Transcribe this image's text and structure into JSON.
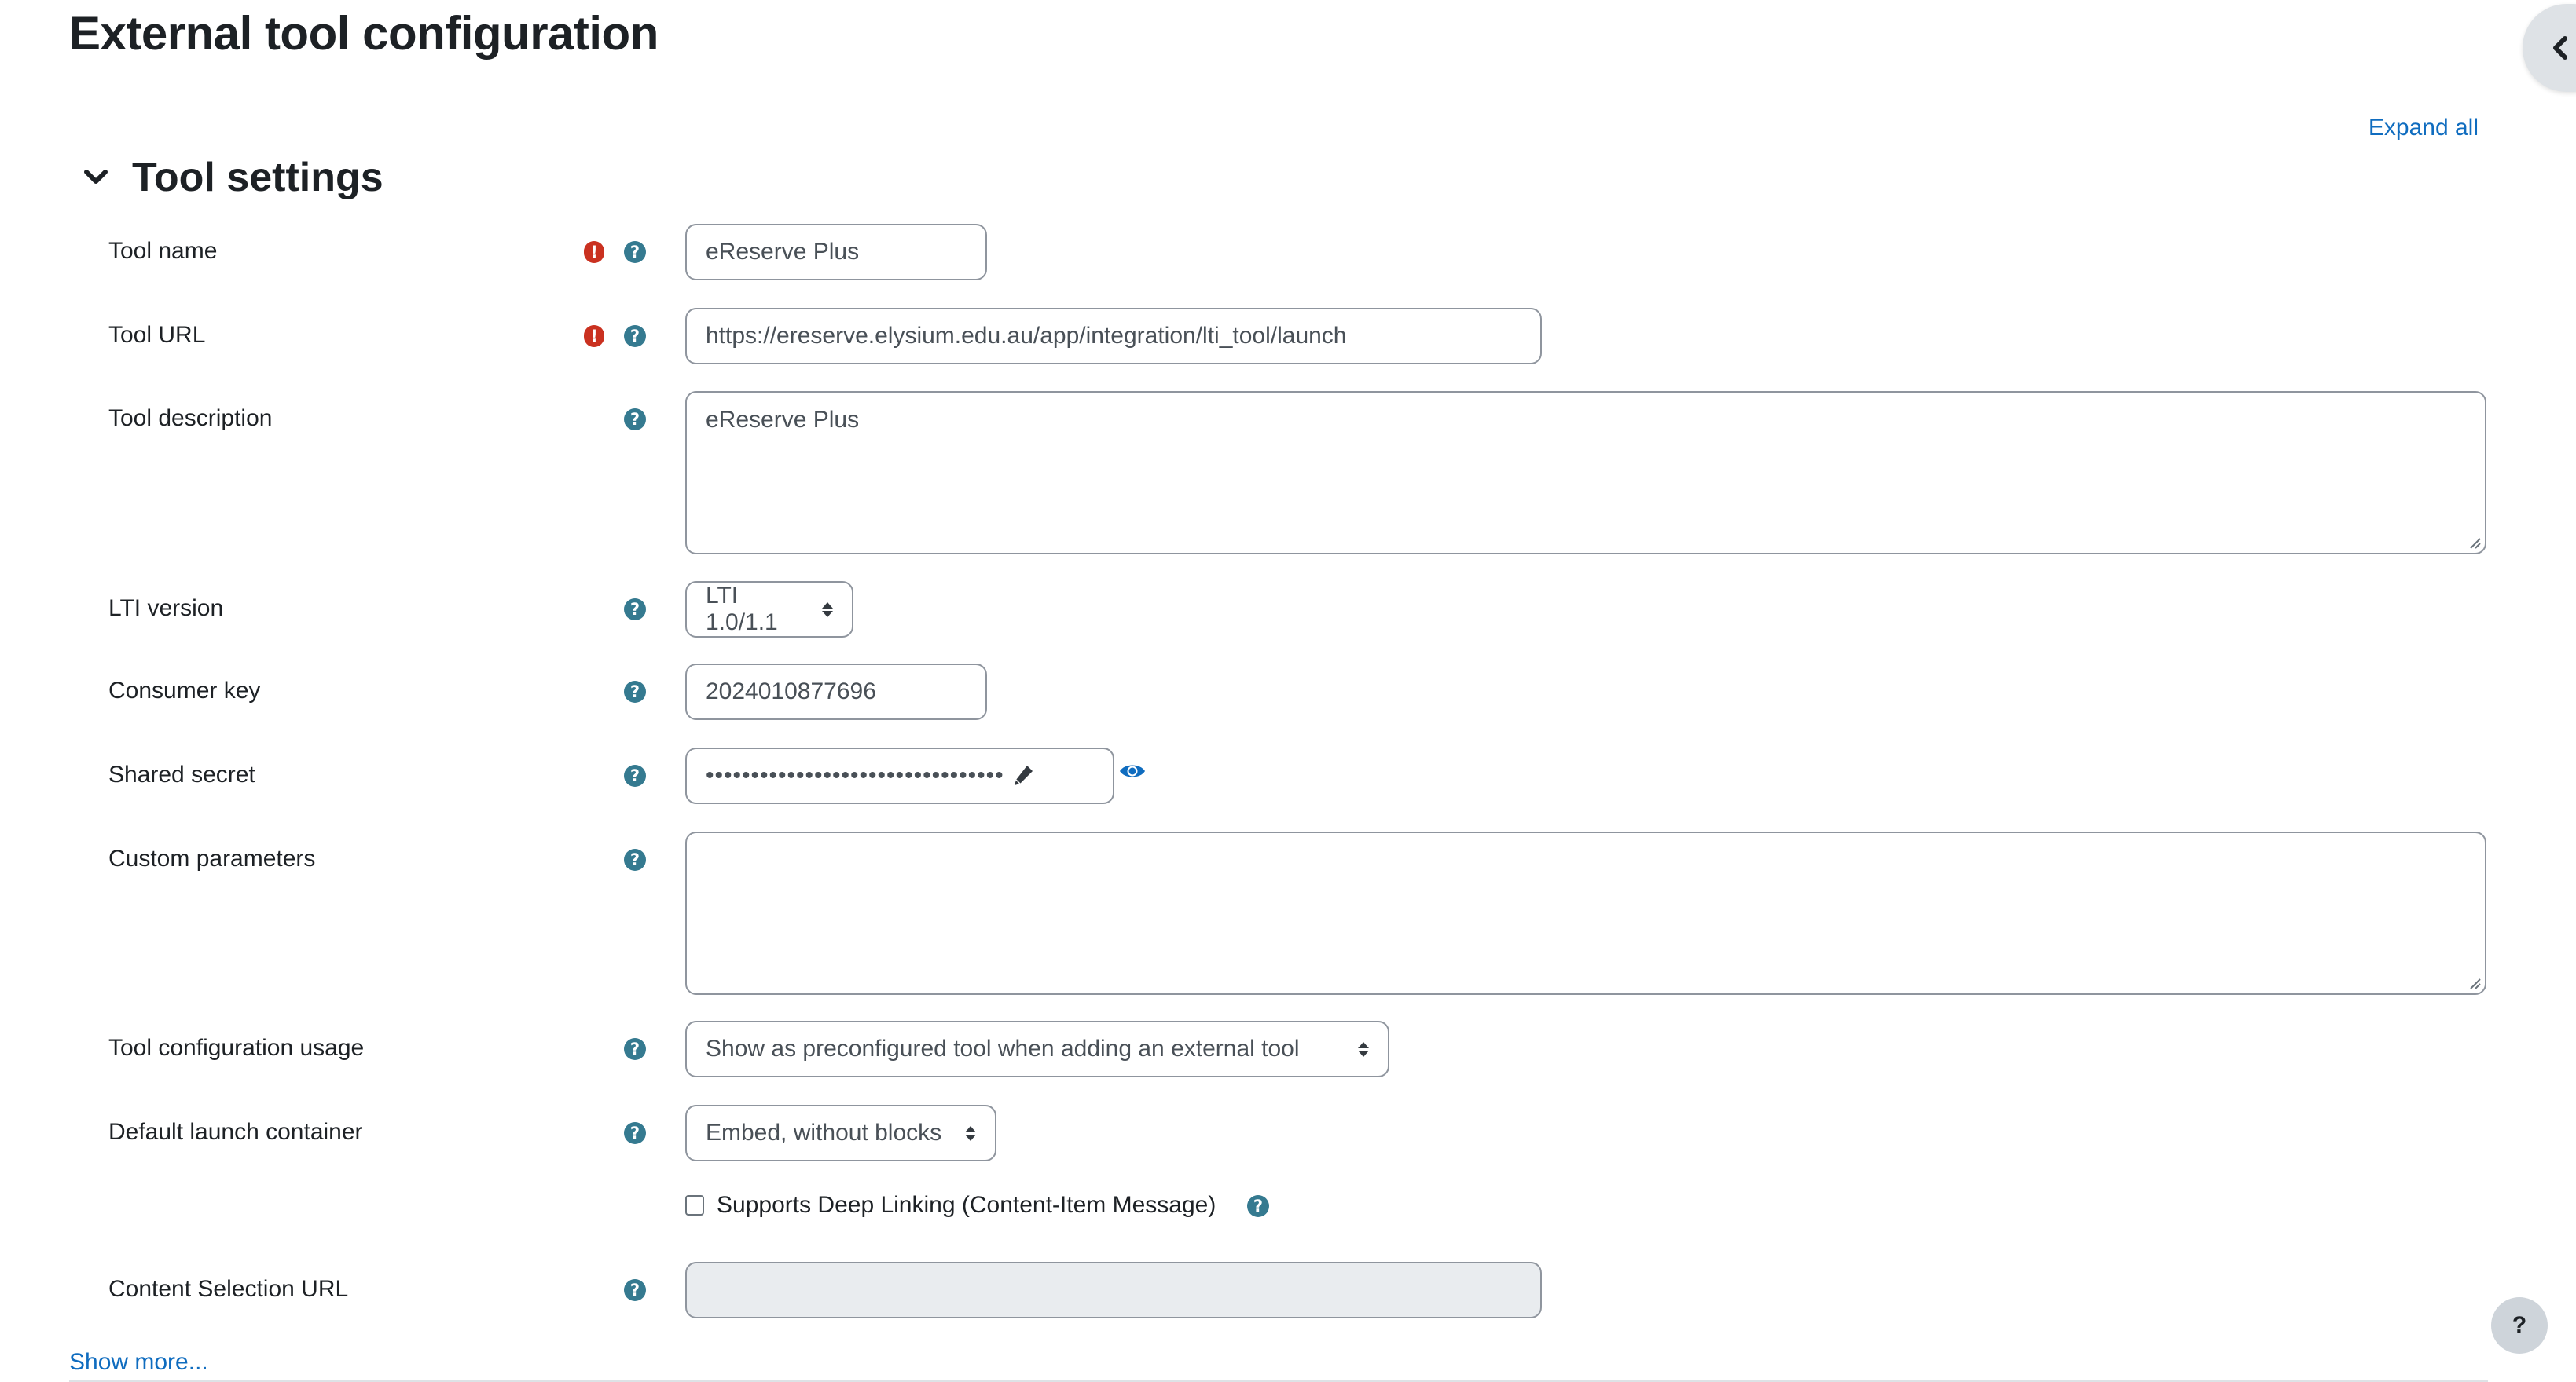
{
  "page": {
    "title": "External tool configuration",
    "expand_all": "Expand all",
    "drawer_toggle_icon": "chevron-left-icon"
  },
  "section": {
    "title": "Tool settings",
    "collapse_icon": "chevron-down-icon"
  },
  "fields": {
    "tool_name": {
      "label": "Tool name",
      "required": true,
      "value": "eReserve Plus"
    },
    "tool_url": {
      "label": "Tool URL",
      "required": true,
      "value": "https://ereserve.elysium.edu.au/app/integration/lti_tool/launch"
    },
    "tool_description": {
      "label": "Tool description",
      "value": "eReserve Plus"
    },
    "lti_version": {
      "label": "LTI version",
      "selected": "LTI 1.0/1.1"
    },
    "consumer_key": {
      "label": "Consumer key",
      "value": "2024010877696"
    },
    "shared_secret": {
      "label": "Shared secret",
      "masked_value": "•••••••••••••••••••••••••••••••••"
    },
    "custom_parameters": {
      "label": "Custom parameters",
      "value": ""
    },
    "tool_config_usage": {
      "label": "Tool configuration usage",
      "selected": "Show as preconfigured tool when adding an external tool"
    },
    "default_launch_container": {
      "label": "Default launch container",
      "selected": "Embed, without blocks"
    },
    "deep_linking": {
      "label": "Supports Deep Linking (Content-Item Message)",
      "checked": false
    },
    "content_selection_url": {
      "label": "Content Selection URL",
      "value": "",
      "disabled": true
    }
  },
  "icons": {
    "required": "!",
    "help": "?"
  },
  "footer": {
    "show_more": "Show more...",
    "help_button": "?"
  },
  "colors": {
    "link": "#0f6cbf",
    "required": "#ca3120",
    "help": "#357a90",
    "text": "#1d2125"
  }
}
